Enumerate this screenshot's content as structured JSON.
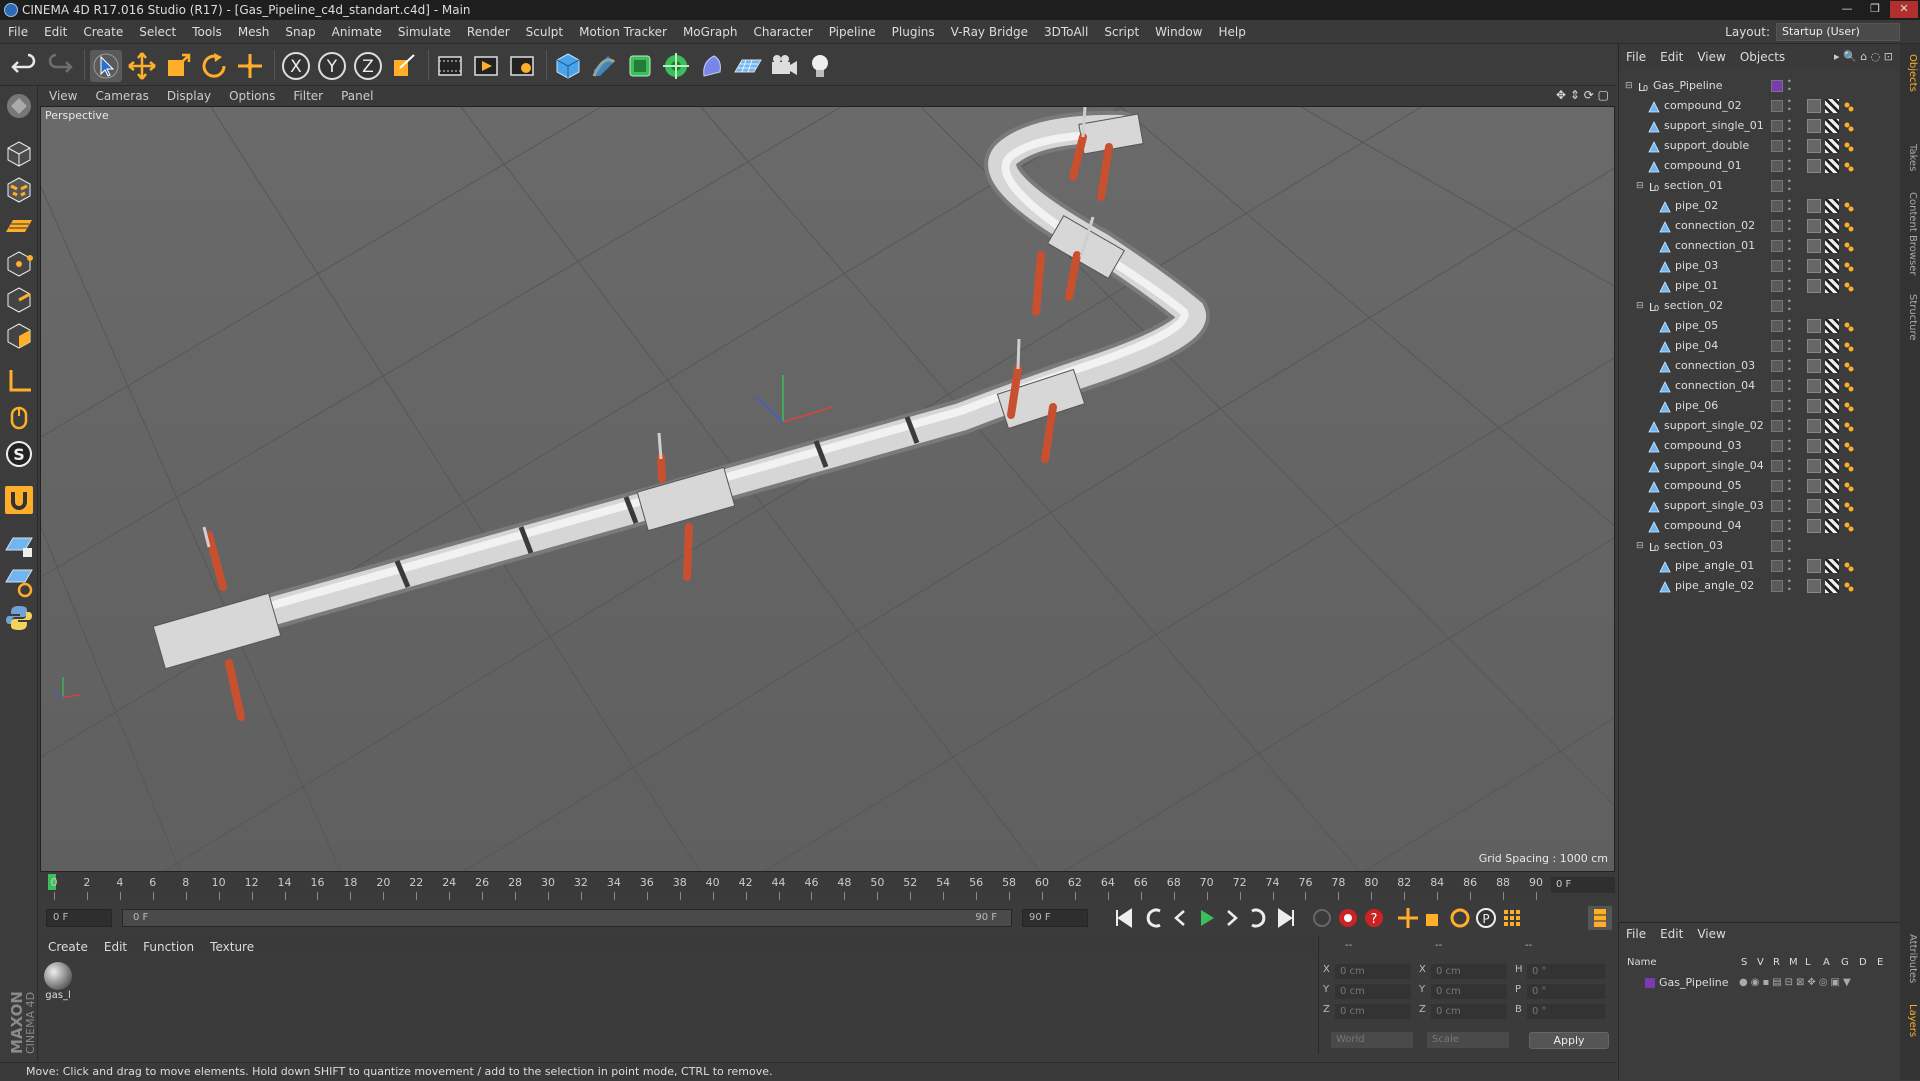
{
  "window": {
    "title": "CINEMA 4D R17.016 Studio (R17) - [Gas_Pipeline_c4d_standart.c4d] - Main",
    "minimize": "—",
    "maximize": "❐",
    "close": "✕"
  },
  "menubar": [
    "File",
    "Edit",
    "Create",
    "Select",
    "Tools",
    "Mesh",
    "Snap",
    "Animate",
    "Simulate",
    "Render",
    "Sculpt",
    "Motion Tracker",
    "MoGraph",
    "Character",
    "Pipeline",
    "Plugins",
    "V-Ray Bridge",
    "3DToAll",
    "Script",
    "Window",
    "Help"
  ],
  "layout": {
    "label": "Layout:",
    "value": "Startup (User)"
  },
  "toolbar": {
    "icons": [
      "undo-icon",
      "redo-icon",
      "select-arrow-icon",
      "move-icon",
      "scale-icon",
      "rotate-icon",
      "transform-icon",
      "x-axis-icon",
      "y-axis-icon",
      "z-axis-icon",
      "coordinate-system-icon",
      "render-view-icon",
      "render-picture-icon",
      "render-settings-icon",
      "cube-icon",
      "pen-icon",
      "subdivision-icon",
      "mograph-icon",
      "deformer-icon",
      "floor-icon",
      "camera-icon",
      "light-icon"
    ],
    "axis_x": "X",
    "axis_y": "Y",
    "axis_z": "Z"
  },
  "viewport": {
    "menu": [
      "View",
      "Cameras",
      "Display",
      "Options",
      "Filter",
      "Panel"
    ],
    "label": "Perspective",
    "grid_spacing": "Grid Spacing : 1000 cm",
    "colors": {
      "background": "#636363",
      "grid": "#565656",
      "pipe": "#d4d4d4",
      "support": "#c8502e"
    }
  },
  "timeline": {
    "ticks": [
      "0",
      "2",
      "4",
      "6",
      "8",
      "10",
      "12",
      "14",
      "16",
      "18",
      "20",
      "22",
      "24",
      "26",
      "28",
      "30",
      "32",
      "34",
      "36",
      "38",
      "40",
      "42",
      "44",
      "46",
      "48",
      "50",
      "52",
      "54",
      "56",
      "58",
      "60",
      "62",
      "64",
      "66",
      "68",
      "70",
      "72",
      "74",
      "76",
      "78",
      "80",
      "82",
      "84",
      "86",
      "88",
      "90"
    ],
    "current_frame": "0 F",
    "start_field": "0 F",
    "range_start": "0 F",
    "range_end": "90 F",
    "end_field": "90 F",
    "end_frame": "0 F"
  },
  "materials": {
    "menu": [
      "Create",
      "Edit",
      "Function",
      "Texture"
    ],
    "items": [
      {
        "name": "gas_l"
      }
    ]
  },
  "coordinates": {
    "header": [
      "--",
      "--",
      "--"
    ],
    "rows": [
      {
        "axis": "X",
        "pos": "0 cm",
        "axis2": "X",
        "size": "0 cm",
        "rlabel": "H",
        "rot": "0 °"
      },
      {
        "axis": "Y",
        "pos": "0 cm",
        "axis2": "Y",
        "size": "0 cm",
        "rlabel": "P",
        "rot": "0 °"
      },
      {
        "axis": "Z",
        "pos": "0 cm",
        "axis2": "Z",
        "size": "0 cm",
        "rlabel": "B",
        "rot": "0 °"
      }
    ],
    "world": "World",
    "scale": "Scale",
    "apply": "Apply"
  },
  "objects": {
    "menu": [
      "File",
      "Edit",
      "View",
      "Objects"
    ],
    "tree": [
      {
        "name": "Gas_Pipeline",
        "level": 0,
        "type": "null"
      },
      {
        "name": "compound_02",
        "level": 1,
        "type": "mesh"
      },
      {
        "name": "support_single_01",
        "level": 1,
        "type": "mesh"
      },
      {
        "name": "support_double",
        "level": 1,
        "type": "mesh"
      },
      {
        "name": "compound_01",
        "level": 1,
        "type": "mesh"
      },
      {
        "name": "section_01",
        "level": 1,
        "type": "null"
      },
      {
        "name": "pipe_02",
        "level": 2,
        "type": "mesh"
      },
      {
        "name": "connection_02",
        "level": 2,
        "type": "mesh"
      },
      {
        "name": "connection_01",
        "level": 2,
        "type": "mesh"
      },
      {
        "name": "pipe_03",
        "level": 2,
        "type": "mesh"
      },
      {
        "name": "pipe_01",
        "level": 2,
        "type": "mesh"
      },
      {
        "name": "section_02",
        "level": 1,
        "type": "null"
      },
      {
        "name": "pipe_05",
        "level": 2,
        "type": "mesh"
      },
      {
        "name": "pipe_04",
        "level": 2,
        "type": "mesh"
      },
      {
        "name": "connection_03",
        "level": 2,
        "type": "mesh"
      },
      {
        "name": "connection_04",
        "level": 2,
        "type": "mesh"
      },
      {
        "name": "pipe_06",
        "level": 2,
        "type": "mesh"
      },
      {
        "name": "support_single_02",
        "level": 1,
        "type": "mesh"
      },
      {
        "name": "compound_03",
        "level": 1,
        "type": "mesh"
      },
      {
        "name": "support_single_04",
        "level": 1,
        "type": "mesh"
      },
      {
        "name": "compound_05",
        "level": 1,
        "type": "mesh"
      },
      {
        "name": "support_single_03",
        "level": 1,
        "type": "mesh"
      },
      {
        "name": "compound_04",
        "level": 1,
        "type": "mesh"
      },
      {
        "name": "section_03",
        "level": 1,
        "type": "null"
      },
      {
        "name": "pipe_angle_01",
        "level": 2,
        "type": "mesh"
      },
      {
        "name": "pipe_angle_02",
        "level": 2,
        "type": "mesh"
      }
    ]
  },
  "side_tabs": [
    "Objects",
    "Takes",
    "Content Browser",
    "Structure",
    "Attributes",
    "Layers"
  ],
  "layers": {
    "menu": [
      "File",
      "Edit",
      "View"
    ],
    "columns": [
      "Name",
      "S",
      "V",
      "R",
      "M",
      "L",
      "A",
      "G",
      "D",
      "E"
    ],
    "items": [
      {
        "name": "Gas_Pipeline"
      }
    ]
  },
  "status": "Move: Click and drag to move elements. Hold down SHIFT to quantize movement / add to the selection in point mode, CTRL to remove.",
  "maxon": {
    "brand": "MAXON",
    "product": "CINEMA 4D"
  }
}
